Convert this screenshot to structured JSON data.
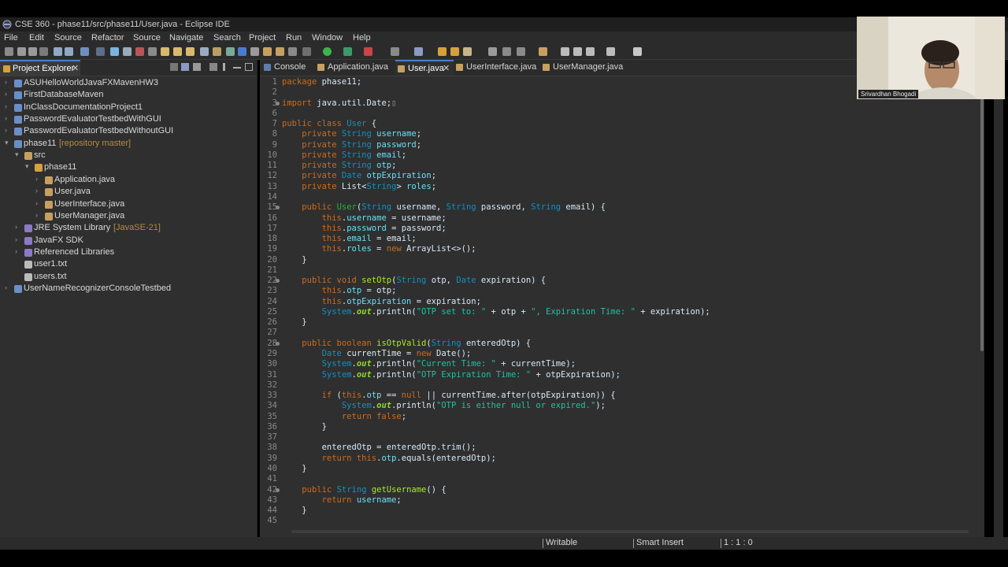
{
  "window": {
    "title": "CSE 360 - phase11/src/phase11/User.java - Eclipse IDE"
  },
  "menu": [
    "File",
    "Edit",
    "Source",
    "Refactor",
    "Source",
    "Navigate",
    "Search",
    "Project",
    "Run",
    "Window",
    "Help"
  ],
  "sidebar": {
    "tab_label": "Project Explorer",
    "tree": [
      {
        "label": "ASUHelloWorldJavaFXMavenHW3",
        "suffix": ""
      },
      {
        "label": "FirstDatabaseMaven",
        "suffix": ""
      },
      {
        "label": "InClassDocumentationProject1",
        "suffix": ""
      },
      {
        "label": "PasswordEvaluatorTestbedWithGUI",
        "suffix": ""
      },
      {
        "label": "PasswordEvaluatorTestbedWithoutGUI",
        "suffix": ""
      },
      {
        "label": "phase11",
        "suffix": "[repository master]"
      },
      {
        "label": "src",
        "suffix": ""
      },
      {
        "label": "phase11",
        "suffix": ""
      },
      {
        "label": "Application.java",
        "suffix": ""
      },
      {
        "label": "User.java",
        "suffix": ""
      },
      {
        "label": "UserInterface.java",
        "suffix": ""
      },
      {
        "label": "UserManager.java",
        "suffix": ""
      },
      {
        "label": "JRE System Library",
        "suffix": "[JavaSE-21]"
      },
      {
        "label": "JavaFX SDK",
        "suffix": ""
      },
      {
        "label": "Referenced Libraries",
        "suffix": ""
      },
      {
        "label": "user1.txt",
        "suffix": ""
      },
      {
        "label": "users.txt",
        "suffix": ""
      },
      {
        "label": "UserNameRecognizerConsoleTestbed",
        "suffix": ""
      }
    ]
  },
  "editor": {
    "tabs": [
      {
        "label": "Console",
        "active": false
      },
      {
        "label": "Application.java",
        "active": false
      },
      {
        "label": "User.java",
        "active": true
      },
      {
        "label": "UserInterface.java",
        "active": false
      },
      {
        "label": "UserManager.java",
        "active": false
      }
    ],
    "close_glyph": "✕",
    "code": [
      {
        "n": "1",
        "fold": false,
        "seg": [
          [
            "kw",
            "package"
          ],
          [
            "tx",
            " phase11;"
          ]
        ]
      },
      {
        "n": "2",
        "fold": false,
        "seg": []
      },
      {
        "n": "3",
        "fold": true,
        "seg": [
          [
            "kw",
            "import"
          ],
          [
            "tx",
            " java.util.Date;"
          ],
          [
            "ik",
            "▯"
          ]
        ]
      },
      {
        "n": "6",
        "fold": false,
        "seg": []
      },
      {
        "n": "7",
        "fold": false,
        "seg": [
          [
            "kw",
            "public class"
          ],
          [
            "tx",
            " "
          ],
          [
            "ty",
            "User"
          ],
          [
            "tx",
            " {"
          ]
        ]
      },
      {
        "n": "8",
        "fold": false,
        "seg": [
          [
            "tx",
            "    "
          ],
          [
            "kw",
            "private"
          ],
          [
            "tx",
            " "
          ],
          [
            "ty",
            "String"
          ],
          [
            "tx",
            " "
          ],
          [
            "fd",
            "username"
          ],
          [
            "tx",
            ";"
          ]
        ]
      },
      {
        "n": "9",
        "fold": false,
        "seg": [
          [
            "tx",
            "    "
          ],
          [
            "kw",
            "private"
          ],
          [
            "tx",
            " "
          ],
          [
            "ty",
            "String"
          ],
          [
            "tx",
            " "
          ],
          [
            "fd",
            "password"
          ],
          [
            "tx",
            ";"
          ]
        ]
      },
      {
        "n": "10",
        "fold": false,
        "seg": [
          [
            "tx",
            "    "
          ],
          [
            "kw",
            "private"
          ],
          [
            "tx",
            " "
          ],
          [
            "ty",
            "String"
          ],
          [
            "tx",
            " "
          ],
          [
            "fd",
            "email"
          ],
          [
            "tx",
            ";"
          ]
        ]
      },
      {
        "n": "11",
        "fold": false,
        "seg": [
          [
            "tx",
            "    "
          ],
          [
            "kw",
            "private"
          ],
          [
            "tx",
            " "
          ],
          [
            "ty",
            "String"
          ],
          [
            "tx",
            " "
          ],
          [
            "fd",
            "otp"
          ],
          [
            "tx",
            ";"
          ]
        ]
      },
      {
        "n": "12",
        "fold": false,
        "seg": [
          [
            "tx",
            "    "
          ],
          [
            "kw",
            "private"
          ],
          [
            "tx",
            " "
          ],
          [
            "ty",
            "Date"
          ],
          [
            "tx",
            " "
          ],
          [
            "fd",
            "otpExpiration"
          ],
          [
            "tx",
            ";"
          ]
        ]
      },
      {
        "n": "13",
        "fold": false,
        "seg": [
          [
            "tx",
            "    "
          ],
          [
            "kw",
            "private"
          ],
          [
            "tx",
            " List<"
          ],
          [
            "ty",
            "String"
          ],
          [
            "tx",
            "> "
          ],
          [
            "fd",
            "roles"
          ],
          [
            "tx",
            ";"
          ]
        ]
      },
      {
        "n": "14",
        "fold": false,
        "seg": []
      },
      {
        "n": "15",
        "fold": true,
        "seg": [
          [
            "tx",
            "    "
          ],
          [
            "kw",
            "public"
          ],
          [
            "tx",
            " "
          ],
          [
            "ob",
            "User"
          ],
          [
            "tx",
            "("
          ],
          [
            "ty",
            "String"
          ],
          [
            "tx",
            " username, "
          ],
          [
            "ty",
            "String"
          ],
          [
            "tx",
            " password, "
          ],
          [
            "ty",
            "String"
          ],
          [
            "tx",
            " email) {"
          ]
        ]
      },
      {
        "n": "16",
        "fold": false,
        "seg": [
          [
            "tx",
            "        "
          ],
          [
            "kw",
            "this"
          ],
          [
            "tx",
            "."
          ],
          [
            "fd",
            "username"
          ],
          [
            "tx",
            " = username;"
          ]
        ]
      },
      {
        "n": "17",
        "fold": false,
        "seg": [
          [
            "tx",
            "        "
          ],
          [
            "kw",
            "this"
          ],
          [
            "tx",
            "."
          ],
          [
            "fd",
            "password"
          ],
          [
            "tx",
            " = password;"
          ]
        ]
      },
      {
        "n": "18",
        "fold": false,
        "seg": [
          [
            "tx",
            "        "
          ],
          [
            "kw",
            "this"
          ],
          [
            "tx",
            "."
          ],
          [
            "fd",
            "email"
          ],
          [
            "tx",
            " = email;"
          ]
        ]
      },
      {
        "n": "19",
        "fold": false,
        "seg": [
          [
            "tx",
            "        "
          ],
          [
            "kw",
            "this"
          ],
          [
            "tx",
            "."
          ],
          [
            "fd",
            "roles"
          ],
          [
            "tx",
            " = "
          ],
          [
            "kw",
            "new"
          ],
          [
            "tx",
            " ArrayList<>();"
          ]
        ]
      },
      {
        "n": "20",
        "fold": false,
        "seg": [
          [
            "tx",
            "    }"
          ]
        ]
      },
      {
        "n": "21",
        "fold": false,
        "seg": []
      },
      {
        "n": "22",
        "fold": true,
        "seg": [
          [
            "tx",
            "    "
          ],
          [
            "kw",
            "public void"
          ],
          [
            "tx",
            " "
          ],
          [
            "fn",
            "setOtp"
          ],
          [
            "tx",
            "("
          ],
          [
            "ty",
            "String"
          ],
          [
            "tx",
            " otp, "
          ],
          [
            "ty",
            "Date"
          ],
          [
            "tx",
            " expiration) {"
          ]
        ]
      },
      {
        "n": "23",
        "fold": false,
        "seg": [
          [
            "tx",
            "        "
          ],
          [
            "kw",
            "this"
          ],
          [
            "tx",
            "."
          ],
          [
            "fd",
            "otp"
          ],
          [
            "tx",
            " = otp;"
          ]
        ]
      },
      {
        "n": "24",
        "fold": false,
        "seg": [
          [
            "tx",
            "        "
          ],
          [
            "kw",
            "this"
          ],
          [
            "tx",
            "."
          ],
          [
            "fd",
            "otpExpiration"
          ],
          [
            "tx",
            " = expiration;"
          ]
        ]
      },
      {
        "n": "25",
        "fold": false,
        "seg": [
          [
            "tx",
            "        "
          ],
          [
            "ty",
            "System"
          ],
          [
            "tx",
            "."
          ],
          [
            "it",
            "out"
          ],
          [
            "tx",
            ".println("
          ],
          [
            "st",
            "\"OTP set to: \""
          ],
          [
            "tx",
            " + otp + "
          ],
          [
            "st",
            "\", Expiration Time: \""
          ],
          [
            "tx",
            " + expiration);"
          ]
        ]
      },
      {
        "n": "26",
        "fold": false,
        "seg": [
          [
            "tx",
            "    }"
          ]
        ]
      },
      {
        "n": "27",
        "fold": false,
        "seg": []
      },
      {
        "n": "28",
        "fold": true,
        "seg": [
          [
            "tx",
            "    "
          ],
          [
            "kw",
            "public boolean"
          ],
          [
            "tx",
            " "
          ],
          [
            "fn",
            "isOtpValid"
          ],
          [
            "tx",
            "("
          ],
          [
            "ty",
            "String"
          ],
          [
            "tx",
            " enteredOtp) {"
          ]
        ]
      },
      {
        "n": "29",
        "fold": false,
        "seg": [
          [
            "tx",
            "        "
          ],
          [
            "ty",
            "Date"
          ],
          [
            "tx",
            " currentTime = "
          ],
          [
            "kw",
            "new"
          ],
          [
            "tx",
            " Date();"
          ]
        ]
      },
      {
        "n": "30",
        "fold": false,
        "seg": [
          [
            "tx",
            "        "
          ],
          [
            "ty",
            "System"
          ],
          [
            "tx",
            "."
          ],
          [
            "it",
            "out"
          ],
          [
            "tx",
            ".println("
          ],
          [
            "st",
            "\"Current Time: \""
          ],
          [
            "tx",
            " + currentTime);"
          ]
        ]
      },
      {
        "n": "31",
        "fold": false,
        "seg": [
          [
            "tx",
            "        "
          ],
          [
            "ty",
            "System"
          ],
          [
            "tx",
            "."
          ],
          [
            "it",
            "out"
          ],
          [
            "tx",
            ".println("
          ],
          [
            "st",
            "\"OTP Expiration Time: \""
          ],
          [
            "tx",
            " + otpExpiration);"
          ]
        ]
      },
      {
        "n": "32",
        "fold": false,
        "seg": []
      },
      {
        "n": "33",
        "fold": false,
        "seg": [
          [
            "tx",
            "        "
          ],
          [
            "kw",
            "if"
          ],
          [
            "tx",
            " ("
          ],
          [
            "kw",
            "this"
          ],
          [
            "tx",
            "."
          ],
          [
            "fd",
            "otp"
          ],
          [
            "tx",
            " == "
          ],
          [
            "kw",
            "null"
          ],
          [
            "tx",
            " || currentTime.after(otpExpiration)) {"
          ]
        ]
      },
      {
        "n": "34",
        "fold": false,
        "seg": [
          [
            "tx",
            "            "
          ],
          [
            "ty",
            "System"
          ],
          [
            "tx",
            "."
          ],
          [
            "it",
            "out"
          ],
          [
            "tx",
            ".println("
          ],
          [
            "st",
            "\"OTP is either null or expired.\""
          ],
          [
            "tx",
            ");"
          ]
        ]
      },
      {
        "n": "35",
        "fold": false,
        "seg": [
          [
            "tx",
            "            "
          ],
          [
            "kw",
            "return false"
          ],
          [
            "tx",
            ";"
          ]
        ]
      },
      {
        "n": "36",
        "fold": false,
        "seg": [
          [
            "tx",
            "        }"
          ]
        ]
      },
      {
        "n": "37",
        "fold": false,
        "seg": []
      },
      {
        "n": "38",
        "fold": false,
        "seg": [
          [
            "tx",
            "        enteredOtp = enteredOtp.trim();"
          ]
        ]
      },
      {
        "n": "39",
        "fold": false,
        "seg": [
          [
            "tx",
            "        "
          ],
          [
            "kw",
            "return this"
          ],
          [
            "tx",
            "."
          ],
          [
            "fd",
            "otp"
          ],
          [
            "tx",
            ".equals(enteredOtp);"
          ]
        ]
      },
      {
        "n": "40",
        "fold": false,
        "seg": [
          [
            "tx",
            "    }"
          ]
        ]
      },
      {
        "n": "41",
        "fold": false,
        "seg": []
      },
      {
        "n": "42",
        "fold": true,
        "seg": [
          [
            "tx",
            "    "
          ],
          [
            "kw",
            "public"
          ],
          [
            "tx",
            " "
          ],
          [
            "ty",
            "String"
          ],
          [
            "tx",
            " "
          ],
          [
            "fn",
            "getUsername"
          ],
          [
            "tx",
            "() {"
          ]
        ]
      },
      {
        "n": "43",
        "fold": false,
        "seg": [
          [
            "tx",
            "        "
          ],
          [
            "kw",
            "return"
          ],
          [
            "tx",
            " "
          ],
          [
            "fd",
            "username"
          ],
          [
            "tx",
            ";"
          ]
        ]
      },
      {
        "n": "44",
        "fold": false,
        "seg": [
          [
            "tx",
            "    }"
          ]
        ]
      },
      {
        "n": "45",
        "fold": false,
        "seg": []
      }
    ]
  },
  "status": {
    "writable": "Writable",
    "insert_mode": "Smart Insert",
    "position": "1 : 1 : 0"
  },
  "webcam": {
    "name": "Srivardhan Bhogadi"
  },
  "colors": {
    "keyword": "#cc6c1d",
    "type": "#1290c3",
    "string": "#17c6a3",
    "field": "#66e1f8",
    "method": "#a7ec21",
    "accent": "#4a7bd0"
  }
}
